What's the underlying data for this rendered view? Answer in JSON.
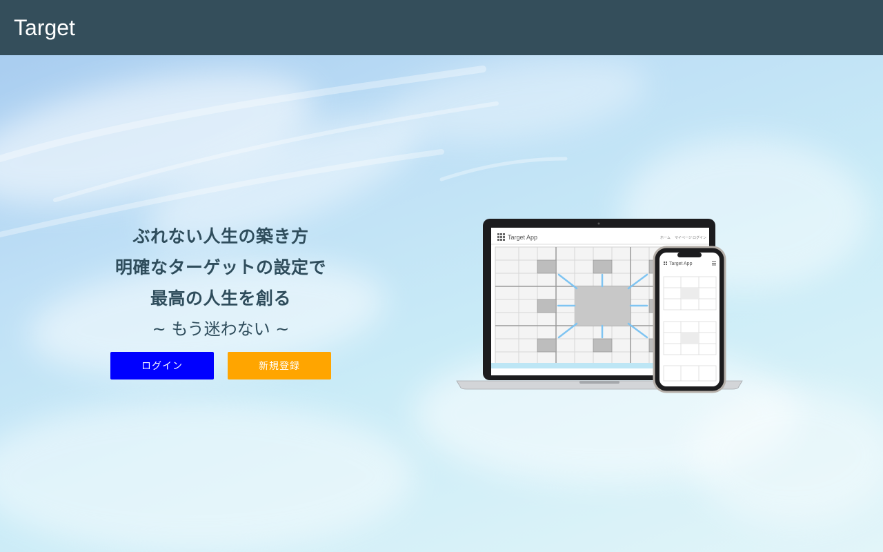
{
  "navbar": {
    "brand": "Target"
  },
  "hero": {
    "headline": [
      "ぶれない人生の築き方",
      "明確なターゲットの設定で",
      "最高の人生を創る"
    ],
    "tagline": "~ もう迷わない ~",
    "buttons": {
      "login": {
        "label": "ログイン",
        "color": "#0000ff"
      },
      "signup": {
        "label": "新規登録",
        "color": "#ffa500"
      }
    }
  },
  "mockup": {
    "laptop_app_title": "Target App",
    "laptop_nav": [
      "ホーム",
      "マイページ",
      "ログイン"
    ],
    "phone_app_title": "Target App"
  },
  "colors": {
    "navbar": "#344e5b",
    "text": "#2f4d5c"
  }
}
